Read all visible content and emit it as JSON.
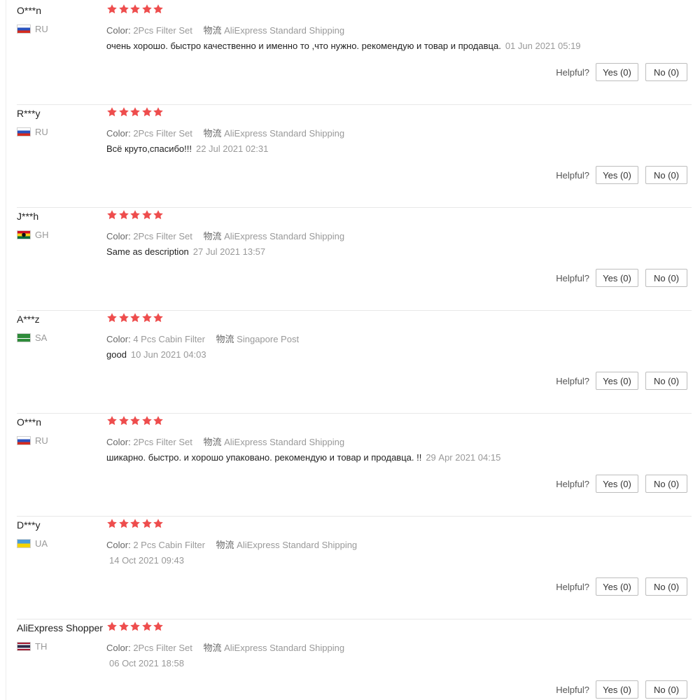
{
  "colors": {
    "star": "#ee4d4d",
    "divider": "#e8e8e8"
  },
  "helpful_label": "Helpful?",
  "meta_labels": {
    "color": "Color:",
    "shipping": "物流"
  },
  "reviews": [
    {
      "buyer": "O***n",
      "country": "RU",
      "flag": "russia-flag-icon",
      "rating": 5,
      "color": "2Pcs Filter Set",
      "shipping": "AliExpress Standard Shipping",
      "text": "очень хорошо. быстро качественно и именно то ,что нужно. рекомендую и товар и продавца.",
      "date": "01 Jun 2021 05:19",
      "yes": "Yes (0)",
      "no": "No (0)"
    },
    {
      "buyer": "R***y",
      "country": "RU",
      "flag": "russia-flag-icon",
      "rating": 5,
      "color": "2Pcs Filter Set",
      "shipping": "AliExpress Standard Shipping",
      "text": "Всё круто,спасибо!!!",
      "date": "22 Jul 2021 02:31",
      "yes": "Yes (0)",
      "no": "No (0)"
    },
    {
      "buyer": "J***h",
      "country": "GH",
      "flag": "ghana-flag-icon",
      "rating": 5,
      "color": "2Pcs Filter Set",
      "shipping": "AliExpress Standard Shipping",
      "text": "Same as description",
      "date": "27 Jul 2021 13:57",
      "yes": "Yes (0)",
      "no": "No (0)"
    },
    {
      "buyer": "A***z",
      "country": "SA",
      "flag": "saudi-arabia-flag-icon",
      "rating": 5,
      "color": "4 Pcs Cabin Filter",
      "shipping": "Singapore Post",
      "text": "good",
      "date": "10 Jun 2021 04:03",
      "yes": "Yes (0)",
      "no": "No (0)"
    },
    {
      "buyer": "O***n",
      "country": "RU",
      "flag": "russia-flag-icon",
      "rating": 5,
      "color": "2Pcs Filter Set",
      "shipping": "AliExpress Standard Shipping",
      "text": "шикарно. быстро. и хорошо упаковано. рекомендую и товар и продавца. !!",
      "date": "29 Apr 2021 04:15",
      "yes": "Yes (0)",
      "no": "No (0)"
    },
    {
      "buyer": "D***y",
      "country": "UA",
      "flag": "ukraine-flag-icon",
      "rating": 5,
      "color": "2 Pcs Cabin Filter",
      "shipping": "AliExpress Standard Shipping",
      "text": "",
      "date": "14 Oct 2021 09:43",
      "yes": "Yes (0)",
      "no": "No (0)"
    },
    {
      "buyer": "AliExpress Shopper",
      "country": "TH",
      "flag": "thailand-flag-icon",
      "rating": 5,
      "color": "2Pcs Filter Set",
      "shipping": "AliExpress Standard Shipping",
      "text": "",
      "date": "06 Oct 2021 18:58",
      "yes": "Yes (0)",
      "no": "No (0)"
    }
  ]
}
